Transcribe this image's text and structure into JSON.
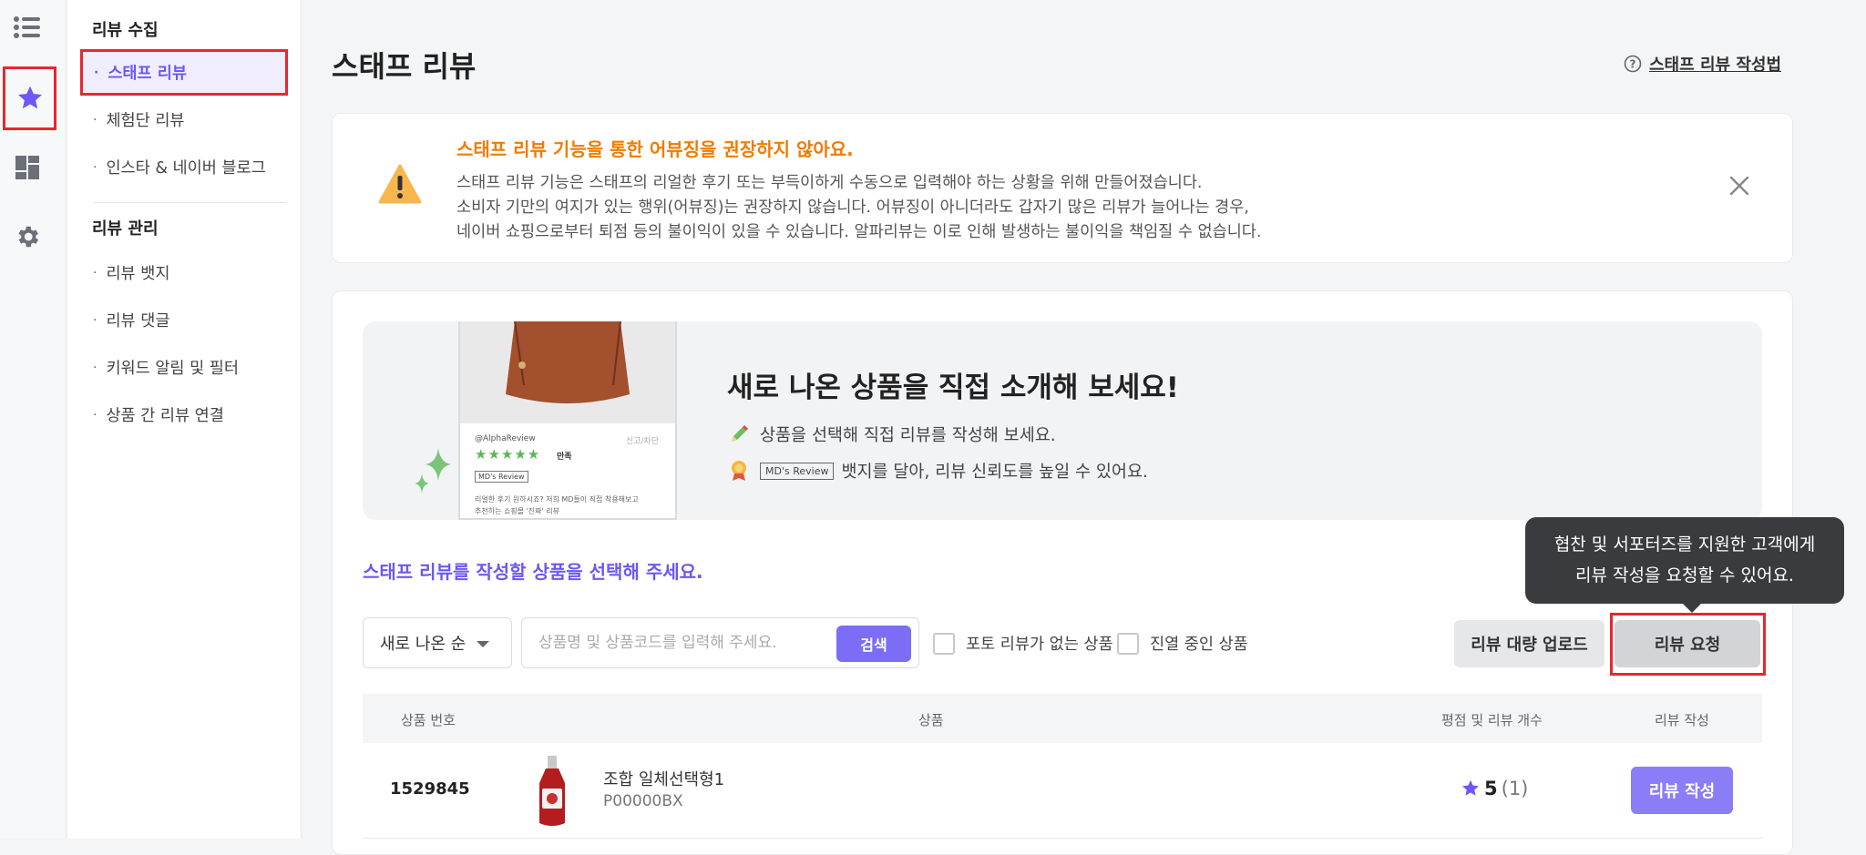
{
  "icon_rail": {
    "items": [
      {
        "icon": "list-icon"
      },
      {
        "icon": "star-icon",
        "active": true
      },
      {
        "icon": "dashboard-icon"
      },
      {
        "icon": "gear-icon"
      }
    ]
  },
  "sidebar": {
    "section1": "리뷰 수집",
    "items1": [
      "스태프 리뷰",
      "체험단 리뷰",
      "인스타 & 네이버 블로그"
    ],
    "section2": "리뷰 관리",
    "items2": [
      "리뷰 뱃지",
      "리뷰 댓글",
      "키워드 알림 및 필터",
      "상품 간 리뷰 연결"
    ]
  },
  "page": {
    "title": "스태프 리뷰",
    "guide_link": "스태프 리뷰 작성법"
  },
  "warning": {
    "title": "스태프 리뷰 기능을 통한 어뷰징을 권장하지 않아요.",
    "lines": [
      "스태프 리뷰 기능은 스태프의 리얼한 후기 또는 부득이하게 수동으로 입력해야 하는 상황을 위해 만들어졌습니다.",
      "소비자 기만의 여지가 있는 행위(어뷰징)는 권장하지 않습니다. 어뷰징이 아니더라도 갑자기 많은 리뷰가 늘어나는 경우,",
      "네이버 쇼핑으로부터 퇴점 등의 불이익이 있을 수 있습니다. 알파리뷰는 이로 인해 발생하는 불이익을 책임질 수 없습니다."
    ]
  },
  "promo": {
    "heading": "새로 나온 상품을 직접 소개해 보세요!",
    "line1": "상품을 선택해 직접 리뷰를 작성해 보세요.",
    "badge": "MD's Review",
    "line2": "뱃지를 달아, 리뷰 신뢰도를 높일 수 있어요.",
    "phone": {
      "user": "@AlphaReview",
      "report": "신고/차단",
      "rating_text": "만족",
      "badge": "MD's Review",
      "text1": "리얼한 후기 원하시죠? 저희 MD들이 직접 착용해보고",
      "text2": "추천하는 쇼핑몰 '진짜' 리뷰"
    }
  },
  "select_title": "스태프 리뷰를 작성할 상품을 선택해 주세요.",
  "filters": {
    "sort_value": "새로 나온 순",
    "search_placeholder": "상품명 및 상품코드를 입력해 주세요.",
    "search_button": "검색",
    "checkbox1": "포토 리뷰가 없는 상품",
    "checkbox2": "진열 중인 상품",
    "bulk_upload": "리뷰 대량 업로드",
    "request": "리뷰 요청"
  },
  "tooltip": {
    "line1": "협찬 및 서포터즈를 지원한 고객에게",
    "line2": "리뷰 작성을 요청할 수 있어요."
  },
  "table": {
    "headers": [
      "상품 번호",
      "상품",
      "평점 및 리뷰 개수",
      "리뷰 작성"
    ],
    "rows": [
      {
        "number": "1529845",
        "name": "조합 일체선택형1",
        "code": "P00000BX",
        "rating": "5",
        "count": "(1)",
        "action": "리뷰 작성"
      }
    ]
  },
  "colors": {
    "accent": "#7c6df6",
    "warning": "#f07c00",
    "highlight": "#e8262f"
  }
}
